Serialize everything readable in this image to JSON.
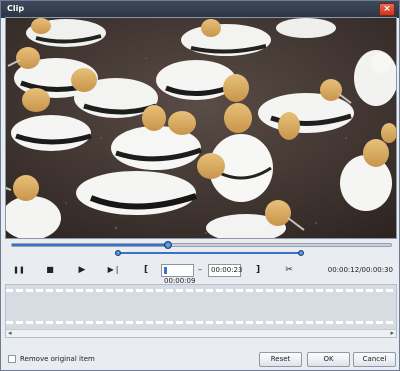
{
  "window": {
    "title": "Clip",
    "close_glyph": "×"
  },
  "player": {
    "progress_fraction": 0.41,
    "trim_start_fraction": 0.28,
    "trim_end_fraction": 0.76,
    "start_time": "00:00:09",
    "range_separator": "–",
    "end_time": "00:00:23",
    "elapsed_total": "00:00:12/00:00:30"
  },
  "controls": {
    "pause_glyph": "❚❚",
    "stop_glyph": "■",
    "next_frame_glyph": "▶",
    "skip_end_glyph": "▶❘",
    "set_start_glyph": "[",
    "set_end_glyph": "]",
    "split_glyph": "✂"
  },
  "scroll": {
    "left_glyph": "◂",
    "right_glyph": "▸"
  },
  "footer": {
    "remove_original_label": "Remove original item",
    "reset_label": "Reset",
    "ok_label": "OK",
    "cancel_label": "Cancel"
  },
  "colors": {
    "accent": "#3774c8",
    "titlebar": "#2a3443",
    "close": "#c8361d"
  }
}
